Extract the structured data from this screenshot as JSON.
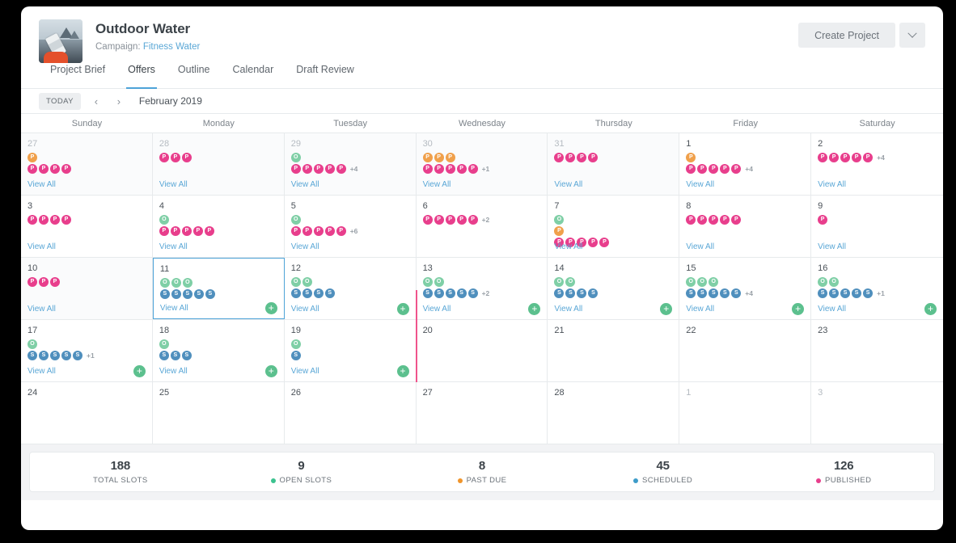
{
  "window": {
    "title": "Outdoor Water"
  },
  "header": {
    "project_title": "Outdoor Water",
    "campaign_prefix": "Campaign:",
    "campaign_name": "Fitness Water",
    "create_button": "Create Project",
    "caret_icon": "chevron-down-icon",
    "thumbnail_alt": "project-thumbnail"
  },
  "tabs": [
    {
      "label": "Project Brief",
      "active": false
    },
    {
      "label": "Offers",
      "active": true
    },
    {
      "label": "Outline",
      "active": false
    },
    {
      "label": "Calendar",
      "active": false
    },
    {
      "label": "Draft Review",
      "active": false
    }
  ],
  "toolbar": {
    "today_label": "TODAY",
    "prev_icon": "chevron-left-icon",
    "next_icon": "chevron-right-icon",
    "prev_glyph": "‹",
    "next_glyph": "›",
    "month_label": "February 2019"
  },
  "calendar": {
    "weekdays": [
      "Sunday",
      "Monday",
      "Tuesday",
      "Wednesday",
      "Thursday",
      "Friday",
      "Saturday"
    ],
    "view_all_label": "View All",
    "add_label": "+",
    "legend": {
      "published": "P",
      "past_due": "P",
      "open": "O",
      "scheduled": "S"
    },
    "weeks": [
      [
        {
          "day": "27",
          "muted": true,
          "shaded": true,
          "selected": false,
          "view_all": true,
          "add": false,
          "rows": [
            {
              "type": "due",
              "count": 1,
              "more": ""
            },
            {
              "type": "pub",
              "count": 4,
              "more": ""
            }
          ]
        },
        {
          "day": "28",
          "muted": true,
          "shaded": true,
          "selected": false,
          "view_all": true,
          "add": false,
          "rows": [
            {
              "type": "pub",
              "count": 3,
              "more": ""
            }
          ]
        },
        {
          "day": "29",
          "muted": true,
          "shaded": true,
          "selected": false,
          "view_all": true,
          "add": false,
          "rows": [
            {
              "type": "open",
              "count": 1,
              "more": ""
            },
            {
              "type": "pub",
              "count": 5,
              "more": "+4"
            }
          ]
        },
        {
          "day": "30",
          "muted": true,
          "shaded": true,
          "selected": false,
          "view_all": true,
          "add": false,
          "rows": [
            {
              "type": "due",
              "count": 3,
              "more": ""
            },
            {
              "type": "pub",
              "count": 5,
              "more": "+1"
            }
          ]
        },
        {
          "day": "31",
          "muted": true,
          "shaded": true,
          "selected": false,
          "view_all": true,
          "add": false,
          "rows": [
            {
              "type": "pub",
              "count": 4,
              "more": ""
            }
          ]
        },
        {
          "day": "1",
          "muted": false,
          "shaded": false,
          "selected": false,
          "view_all": true,
          "add": false,
          "rows": [
            {
              "type": "due",
              "count": 1,
              "more": ""
            },
            {
              "type": "pub",
              "count": 5,
              "more": "+4"
            }
          ]
        },
        {
          "day": "2",
          "muted": false,
          "shaded": false,
          "selected": false,
          "view_all": true,
          "add": false,
          "rows": [
            {
              "type": "pub",
              "count": 5,
              "more": "+4"
            }
          ]
        }
      ],
      [
        {
          "day": "3",
          "muted": false,
          "shaded": false,
          "selected": false,
          "view_all": true,
          "add": false,
          "rows": [
            {
              "type": "pub",
              "count": 4,
              "more": ""
            }
          ]
        },
        {
          "day": "4",
          "muted": false,
          "shaded": false,
          "selected": false,
          "view_all": true,
          "add": false,
          "rows": [
            {
              "type": "open",
              "count": 1,
              "more": ""
            },
            {
              "type": "pub",
              "count": 5,
              "more": ""
            }
          ]
        },
        {
          "day": "5",
          "muted": false,
          "shaded": false,
          "selected": false,
          "view_all": true,
          "add": false,
          "rows": [
            {
              "type": "open",
              "count": 1,
              "more": ""
            },
            {
              "type": "pub",
              "count": 5,
              "more": "+6"
            }
          ]
        },
        {
          "day": "6",
          "muted": false,
          "shaded": false,
          "selected": false,
          "view_all": false,
          "add": false,
          "rows": [
            {
              "type": "pub",
              "count": 5,
              "more": "+2"
            }
          ]
        },
        {
          "day": "7",
          "muted": false,
          "shaded": false,
          "selected": false,
          "view_all": true,
          "add": false,
          "rows": [
            {
              "type": "open",
              "count": 1,
              "more": ""
            },
            {
              "type": "due",
              "count": 1,
              "more": ""
            },
            {
              "type": "pub",
              "count": 5,
              "more": ""
            }
          ]
        },
        {
          "day": "8",
          "muted": false,
          "shaded": false,
          "selected": false,
          "view_all": true,
          "add": false,
          "rows": [
            {
              "type": "pub",
              "count": 5,
              "more": ""
            }
          ]
        },
        {
          "day": "9",
          "muted": false,
          "shaded": false,
          "selected": false,
          "view_all": true,
          "add": false,
          "rows": [
            {
              "type": "pub",
              "count": 1,
              "more": ""
            }
          ]
        }
      ],
      [
        {
          "day": "10",
          "muted": false,
          "shaded": true,
          "selected": false,
          "view_all": true,
          "add": false,
          "rows": [
            {
              "type": "pub",
              "count": 3,
              "more": ""
            }
          ]
        },
        {
          "day": "11",
          "muted": false,
          "shaded": false,
          "selected": true,
          "view_all": true,
          "add": true,
          "rows": [
            {
              "type": "open",
              "count": 3,
              "more": ""
            },
            {
              "type": "sch",
              "count": 5,
              "more": ""
            }
          ]
        },
        {
          "day": "12",
          "muted": false,
          "shaded": false,
          "selected": false,
          "view_all": true,
          "add": true,
          "rows": [
            {
              "type": "open",
              "count": 2,
              "more": ""
            },
            {
              "type": "sch",
              "count": 4,
              "more": ""
            }
          ]
        },
        {
          "day": "13",
          "muted": false,
          "shaded": false,
          "selected": false,
          "view_all": true,
          "add": true,
          "rows": [
            {
              "type": "open",
              "count": 2,
              "more": ""
            },
            {
              "type": "sch",
              "count": 5,
              "more": "+2"
            }
          ]
        },
        {
          "day": "14",
          "muted": false,
          "shaded": false,
          "selected": false,
          "view_all": true,
          "add": true,
          "rows": [
            {
              "type": "open",
              "count": 2,
              "more": ""
            },
            {
              "type": "sch",
              "count": 4,
              "more": ""
            }
          ]
        },
        {
          "day": "15",
          "muted": false,
          "shaded": false,
          "selected": false,
          "view_all": true,
          "add": true,
          "rows": [
            {
              "type": "open",
              "count": 3,
              "more": ""
            },
            {
              "type": "sch",
              "count": 5,
              "more": "+4"
            }
          ]
        },
        {
          "day": "16",
          "muted": false,
          "shaded": false,
          "selected": false,
          "view_all": true,
          "add": true,
          "rows": [
            {
              "type": "open",
              "count": 2,
              "more": ""
            },
            {
              "type": "sch",
              "count": 5,
              "more": "+1"
            }
          ]
        }
      ],
      [
        {
          "day": "17",
          "muted": false,
          "shaded": false,
          "selected": false,
          "view_all": true,
          "add": true,
          "rows": [
            {
              "type": "open",
              "count": 1,
              "more": ""
            },
            {
              "type": "sch",
              "count": 5,
              "more": "+1"
            }
          ]
        },
        {
          "day": "18",
          "muted": false,
          "shaded": false,
          "selected": false,
          "view_all": true,
          "add": true,
          "rows": [
            {
              "type": "open",
              "count": 1,
              "more": ""
            },
            {
              "type": "sch",
              "count": 3,
              "more": ""
            }
          ]
        },
        {
          "day": "19",
          "muted": false,
          "shaded": false,
          "selected": false,
          "view_all": true,
          "add": true,
          "rows": [
            {
              "type": "open",
              "count": 1,
              "more": ""
            },
            {
              "type": "sch",
              "count": 1,
              "more": ""
            }
          ]
        },
        {
          "day": "20",
          "muted": false,
          "shaded": false,
          "selected": false,
          "view_all": false,
          "add": false,
          "rows": []
        },
        {
          "day": "21",
          "muted": false,
          "shaded": false,
          "selected": false,
          "view_all": false,
          "add": false,
          "rows": []
        },
        {
          "day": "22",
          "muted": false,
          "shaded": false,
          "selected": false,
          "view_all": false,
          "add": false,
          "rows": []
        },
        {
          "day": "23",
          "muted": false,
          "shaded": false,
          "selected": false,
          "view_all": false,
          "add": false,
          "rows": []
        }
      ],
      [
        {
          "day": "24",
          "muted": false,
          "shaded": false,
          "selected": false,
          "view_all": false,
          "add": false,
          "rows": []
        },
        {
          "day": "25",
          "muted": false,
          "shaded": false,
          "selected": false,
          "view_all": false,
          "add": false,
          "rows": []
        },
        {
          "day": "26",
          "muted": false,
          "shaded": false,
          "selected": false,
          "view_all": false,
          "add": false,
          "rows": []
        },
        {
          "day": "27",
          "muted": false,
          "shaded": false,
          "selected": false,
          "view_all": false,
          "add": false,
          "rows": []
        },
        {
          "day": "28",
          "muted": false,
          "shaded": false,
          "selected": false,
          "view_all": false,
          "add": false,
          "rows": []
        },
        {
          "day": "1",
          "muted": true,
          "shaded": false,
          "selected": false,
          "view_all": false,
          "add": false,
          "rows": []
        },
        {
          "day": "3",
          "muted": true,
          "shaded": false,
          "selected": false,
          "view_all": false,
          "add": false,
          "rows": []
        }
      ]
    ]
  },
  "stats": [
    {
      "value": "188",
      "label": "TOTAL SLOTS",
      "color": ""
    },
    {
      "value": "9",
      "label": "OPEN SLOTS",
      "color": "#3cc28f"
    },
    {
      "value": "8",
      "label": "PAST DUE",
      "color": "#f0952b"
    },
    {
      "value": "45",
      "label": "SCHEDULED",
      "color": "#3d9cc9"
    },
    {
      "value": "126",
      "label": "PUBLISHED",
      "color": "#e83e8c"
    }
  ],
  "colors": {
    "published": "#e83e8c",
    "past_due": "#f0a04b",
    "open": "#7fcfa6",
    "scheduled": "#4f8fbd",
    "accent": "#4ea3d8",
    "today_line": "#f0548c",
    "add_button": "#5cc08e"
  }
}
